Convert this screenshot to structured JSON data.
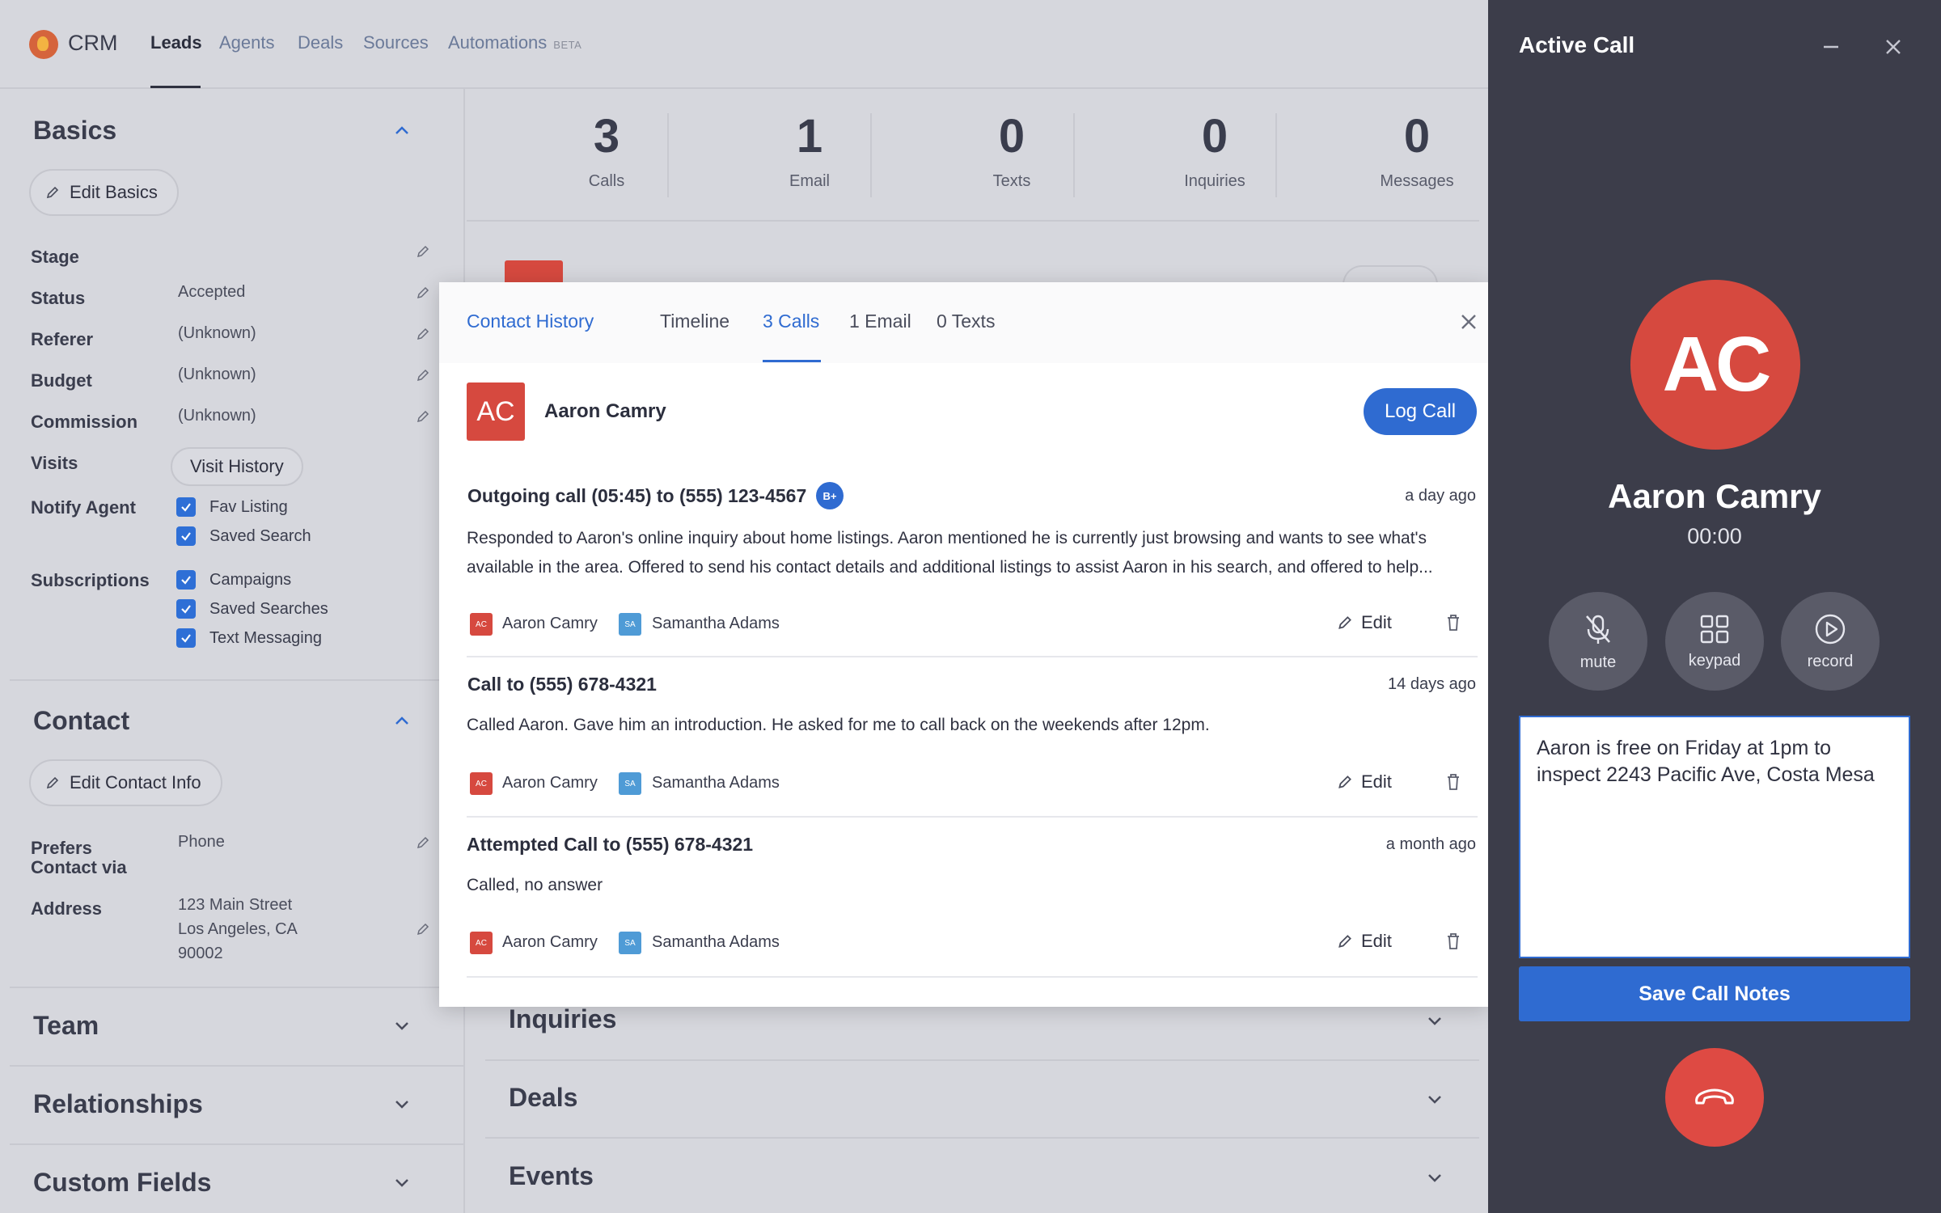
{
  "nav": {
    "brand": "CRM",
    "items": [
      {
        "label": "Leads",
        "active": true
      },
      {
        "label": "Agents"
      },
      {
        "label": "Deals"
      },
      {
        "label": "Sources"
      },
      {
        "label": "Automations",
        "badge": "BETA"
      }
    ]
  },
  "basics": {
    "title": "Basics",
    "edit_label": "Edit Basics",
    "fields": [
      {
        "label": "Stage",
        "value": ""
      },
      {
        "label": "Status",
        "value": "Accepted"
      },
      {
        "label": "Referer",
        "value": "(Unknown)"
      },
      {
        "label": "Budget",
        "value": "(Unknown)"
      },
      {
        "label": "Commission",
        "value": "(Unknown)"
      }
    ],
    "visits_label": "Visits",
    "visit_history_label": "Visit History",
    "notify_label": "Notify Agent",
    "notify_options": [
      "Fav Listing",
      "Saved Search"
    ],
    "subscriptions_label": "Subscriptions",
    "subscription_options": [
      "Campaigns",
      "Saved Searches",
      "Text Messaging"
    ]
  },
  "contact": {
    "title": "Contact",
    "edit_label": "Edit Contact Info",
    "prefers_label_1": "Prefers",
    "prefers_label_2": "Contact via",
    "prefers_value": "Phone",
    "address_label": "Address",
    "address_lines": [
      "123 Main Street",
      "Los Angeles, CA",
      "90002"
    ]
  },
  "collapsed_sections": [
    "Team",
    "Relationships",
    "Custom Fields"
  ],
  "stats": [
    {
      "value": "3",
      "label": "Calls"
    },
    {
      "value": "1",
      "label": "Email"
    },
    {
      "value": "0",
      "label": "Texts"
    },
    {
      "value": "0",
      "label": "Inquiries"
    },
    {
      "value": "0",
      "label": "Messages"
    }
  ],
  "center_sections": [
    "Inquiries",
    "Deals",
    "Events"
  ],
  "modal": {
    "tabs": [
      "Contact History",
      "Timeline",
      "3 Calls",
      "1 Email",
      "0 Texts"
    ],
    "contact_initials": "AC",
    "contact_name": "Aaron Camry",
    "log_call_label": "Log Call",
    "calls": [
      {
        "title": "Outgoing call (05:45) to (555) 123-4567",
        "badge": "B+",
        "when": "a day ago",
        "desc_1": "Responded to Aaron's online inquiry about home listings. Aaron mentioned he is currently just browsing and wants to see what's",
        "desc_2": "available in the area. Offered to send his contact details and additional listings to assist Aaron in his search, and offered to help...",
        "from": "Aaron Camry",
        "agent": "Samantha Adams",
        "edit": "Edit"
      },
      {
        "title": "Call to (555) 678-4321",
        "when": "14 days ago",
        "desc_1": "Called Aaron. Gave him an introduction. He asked for me to call back on the weekends after 12pm.",
        "from": "Aaron Camry",
        "agent": "Samantha Adams",
        "edit": "Edit"
      },
      {
        "title": "Attempted Call to (555) 678-4321",
        "when": "a month ago",
        "desc_1": "Called, no answer",
        "from": "Aaron Camry",
        "agent": "Samantha Adams",
        "edit": "Edit"
      }
    ],
    "mini_from": "AC",
    "mini_agent": "SA"
  },
  "call_panel": {
    "title": "Active Call",
    "initials": "AC",
    "name": "Aaron Camry",
    "timer": "00:00",
    "controls": [
      "mute",
      "keypad",
      "record"
    ],
    "notes": "Aaron is free on Friday at 1pm to inspect 2243 Pacific Ave, Costa Mesa",
    "save_label": "Save Call Notes"
  },
  "colors": {
    "accent": "#2f6bd1",
    "avatar": "#d6493f",
    "panel_dark": "#3c3d4a",
    "hangup": "#de4a43",
    "agent_avatar": "#4f9bd6"
  }
}
